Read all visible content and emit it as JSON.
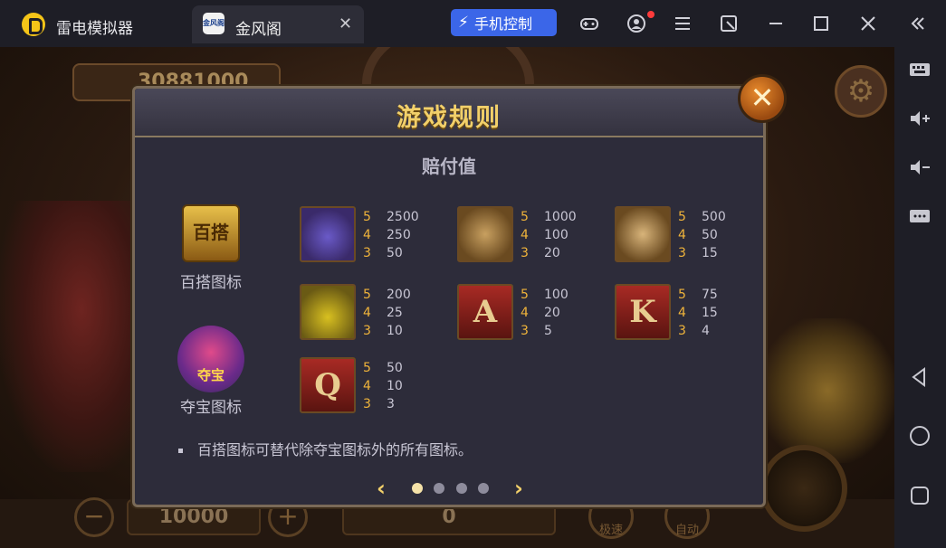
{
  "titlebar": {
    "app_name": "雷电模拟器",
    "tab": {
      "icon_text": "金风阁",
      "label": "金风阁",
      "close": "✕"
    },
    "phone_control": "手机控制",
    "icons": [
      "gamepad-icon",
      "account-icon",
      "menu-icon",
      "resize-icon",
      "minimize-icon",
      "maximize-icon",
      "close-icon",
      "collapse-sidebar-icon"
    ]
  },
  "sidebar": {
    "items": [
      "keyboard-icon",
      "volume-up-icon",
      "volume-down-icon",
      "more-icon",
      "back-icon",
      "home-icon",
      "recent-apps-icon"
    ]
  },
  "game": {
    "balance": "30881000",
    "bet": "10000",
    "win": "0",
    "buttons": {
      "max_bet": "极速",
      "auto": "自动"
    }
  },
  "modal": {
    "title": "游戏规则",
    "section_title": "赔付值",
    "specials": [
      {
        "icon_text": "百搭",
        "label": "百搭图标"
      },
      {
        "icon_text": "夺宝",
        "label": "夺宝图标"
      }
    ],
    "symbols": [
      {
        "name": "captain",
        "counts": [
          "5",
          "4",
          "3"
        ],
        "values": [
          "2500",
          "250",
          "50"
        ]
      },
      {
        "name": "hook",
        "counts": [
          "5",
          "4",
          "3"
        ],
        "values": [
          "1000",
          "100",
          "20"
        ]
      },
      {
        "name": "compass",
        "counts": [
          "5",
          "4",
          "3"
        ],
        "values": [
          "500",
          "50",
          "15"
        ]
      },
      {
        "name": "bottle",
        "counts": [
          "5",
          "4",
          "3"
        ],
        "values": [
          "200",
          "25",
          "10"
        ]
      },
      {
        "name": "A",
        "letter": "A",
        "counts": [
          "5",
          "4",
          "3"
        ],
        "values": [
          "100",
          "20",
          "5"
        ]
      },
      {
        "name": "K",
        "letter": "K",
        "counts": [
          "5",
          "4",
          "3"
        ],
        "values": [
          "75",
          "15",
          "4"
        ]
      },
      {
        "name": "Q",
        "letter": "Q",
        "counts": [
          "5",
          "4",
          "3"
        ],
        "values": [
          "50",
          "10",
          "3"
        ]
      }
    ],
    "note": "百搭图标可替代除夺宝图标外的所有图标。",
    "pager": {
      "pages": 4,
      "current": 1
    }
  },
  "colors": {
    "accent": "#3b66e8",
    "title_gold": "#f2d06a",
    "count_orange": "#f0b43a",
    "modal_bg": "#2d2c3a"
  }
}
